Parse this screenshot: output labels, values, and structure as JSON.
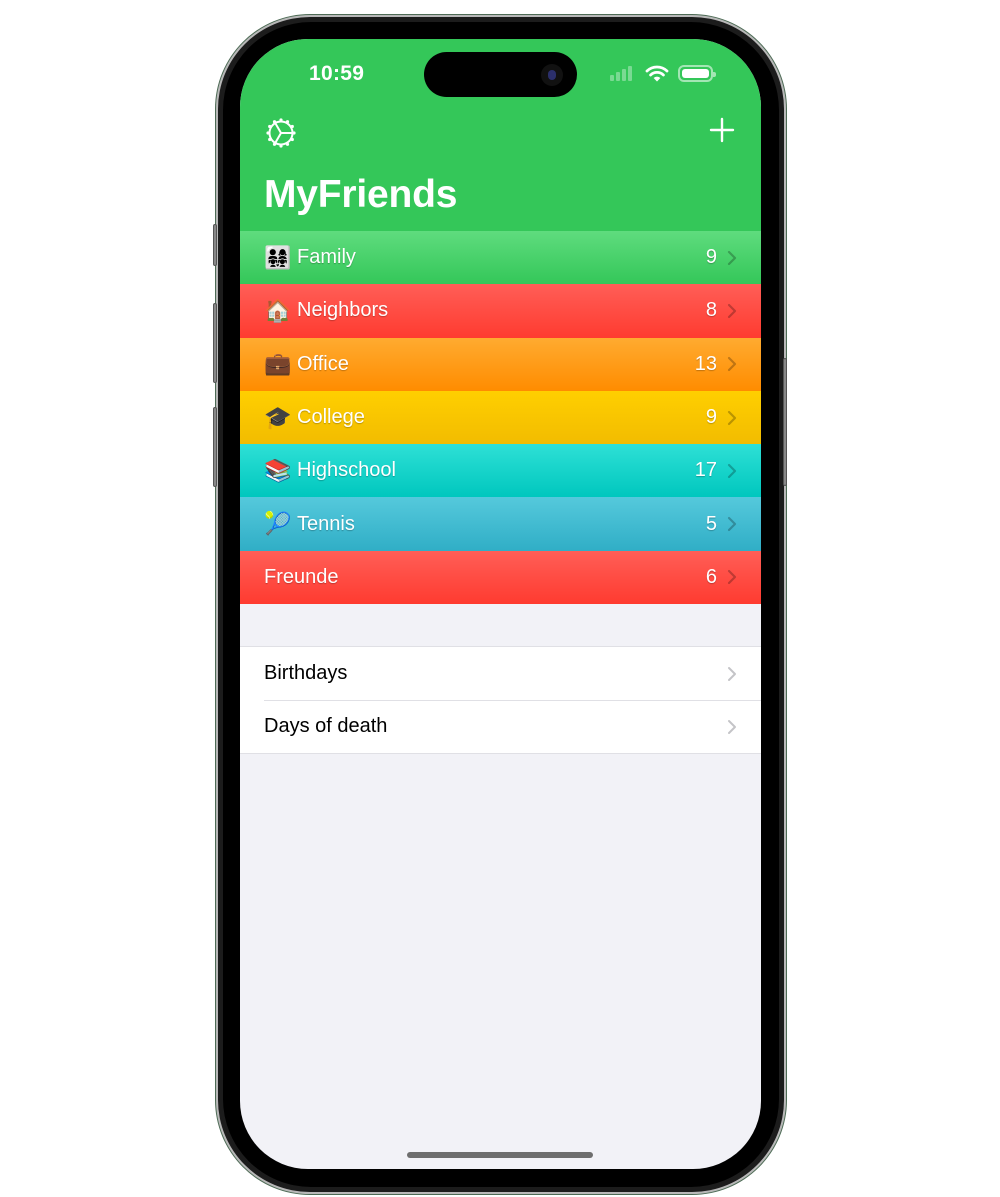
{
  "status_bar": {
    "time": "10:59",
    "signal_icon": "cellular-signal-icon",
    "wifi_icon": "wifi-icon",
    "battery_icon": "battery-icon"
  },
  "navbar": {
    "settings_icon": "gear-icon",
    "add_icon": "plus-icon",
    "title": "MyFriends",
    "background_color": "#34c759"
  },
  "groups": [
    {
      "emoji": "👨‍👩‍👧‍👧",
      "label": "Family",
      "count": "9",
      "color_top": "#5fdc7e",
      "color_bottom": "#34c759"
    },
    {
      "emoji": "🏠",
      "label": "Neighbors",
      "count": "8",
      "color_top": "#ff5e57",
      "color_bottom": "#ff3b30"
    },
    {
      "emoji": "💼",
      "label": "Office",
      "count": "13",
      "color_top": "#ffab30",
      "color_bottom": "#ff8c00"
    },
    {
      "emoji": "🎓",
      "label": "College",
      "count": "9",
      "color_top": "#ffcf00",
      "color_bottom": "#f2bc00"
    },
    {
      "emoji": "📚",
      "label": "Highschool",
      "count": "17",
      "color_top": "#2ee0d6",
      "color_bottom": "#00c7be"
    },
    {
      "emoji": "🎾",
      "label": "Tennis",
      "count": "5",
      "color_top": "#55c9dc",
      "color_bottom": "#30aec6"
    },
    {
      "emoji": "",
      "label": "Freunde",
      "count": "6",
      "color_top": "#ff5e57",
      "color_bottom": "#ff3b30"
    }
  ],
  "lists": [
    {
      "label": "Birthdays"
    },
    {
      "label": "Days of death"
    }
  ]
}
